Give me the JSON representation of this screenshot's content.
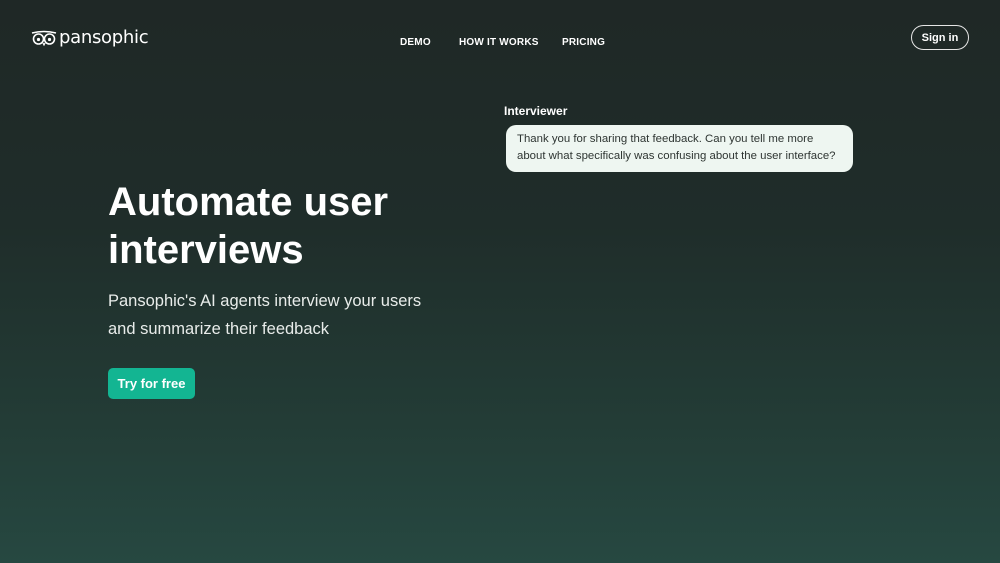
{
  "brand": {
    "name": "pansophic",
    "logo_icon": "owl-eyes-icon"
  },
  "nav": {
    "items": [
      {
        "label": "DEMO"
      },
      {
        "label": "HOW IT WORKS"
      },
      {
        "label": "PRICING"
      }
    ],
    "signin_label": "Sign in"
  },
  "hero": {
    "title": "Automate user interviews",
    "subtitle": "Pansophic's AI agents interview your users and summarize their feedback",
    "cta_label": "Try for free"
  },
  "chat": {
    "speaker": "Interviewer",
    "message": "Thank you for sharing that feedback. Can you tell me more about what specifically was confusing about the user interface?"
  },
  "colors": {
    "accent": "#13b592",
    "background_top": "#1f2826",
    "background_bottom": "#264841",
    "bubble": "#eef6f1"
  }
}
